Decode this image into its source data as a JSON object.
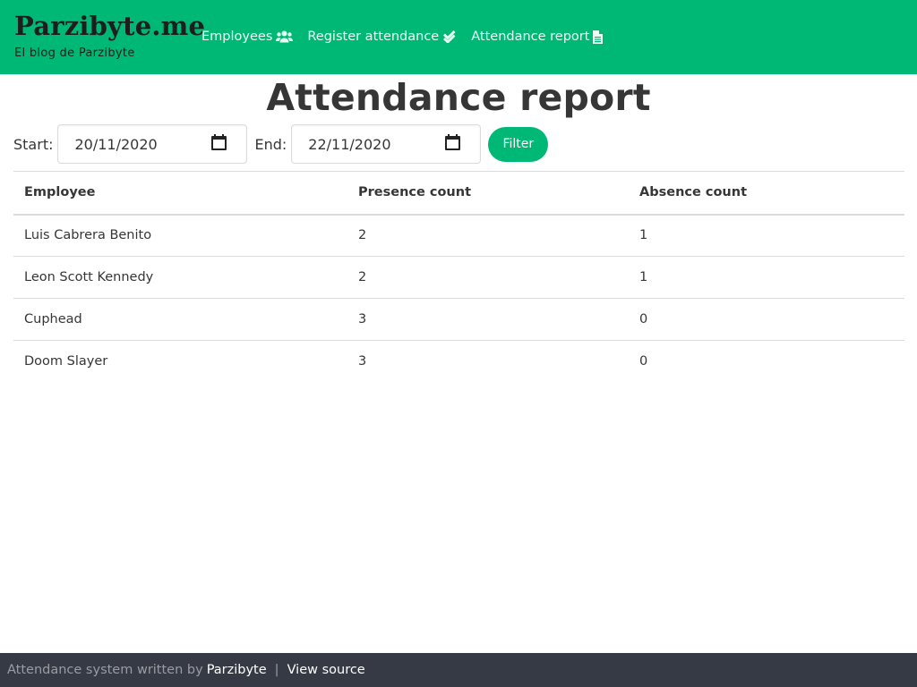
{
  "brand": {
    "title": "Parzibyte.me",
    "subtitle": "El blog de Parzibyte"
  },
  "nav": [
    {
      "label": "Employees",
      "icon": "users-icon"
    },
    {
      "label": "Register attendance",
      "icon": "double-check-icon"
    },
    {
      "label": "Attendance report",
      "icon": "file-icon"
    }
  ],
  "page": {
    "title": "Attendance report"
  },
  "filters": {
    "start_label": "Start:",
    "start_value": "20/11/2020",
    "end_label": "End:",
    "end_value": "22/11/2020",
    "button_label": "Filter"
  },
  "table": {
    "headers": [
      "Employee",
      "Presence count",
      "Absence count"
    ],
    "rows": [
      [
        "Luis Cabrera Benito",
        "2",
        "1"
      ],
      [
        "Leon Scott Kennedy",
        "2",
        "1"
      ],
      [
        "Cuphead",
        "3",
        "0"
      ],
      [
        "Doom Slayer",
        "3",
        "0"
      ]
    ]
  },
  "footer": {
    "text": "Attendance system written by",
    "author_link": "Parzibyte",
    "separator": "|",
    "source_link": "View source"
  },
  "colors": {
    "primary": "#00b875",
    "footer_bg": "#363a44",
    "text": "#363636"
  }
}
